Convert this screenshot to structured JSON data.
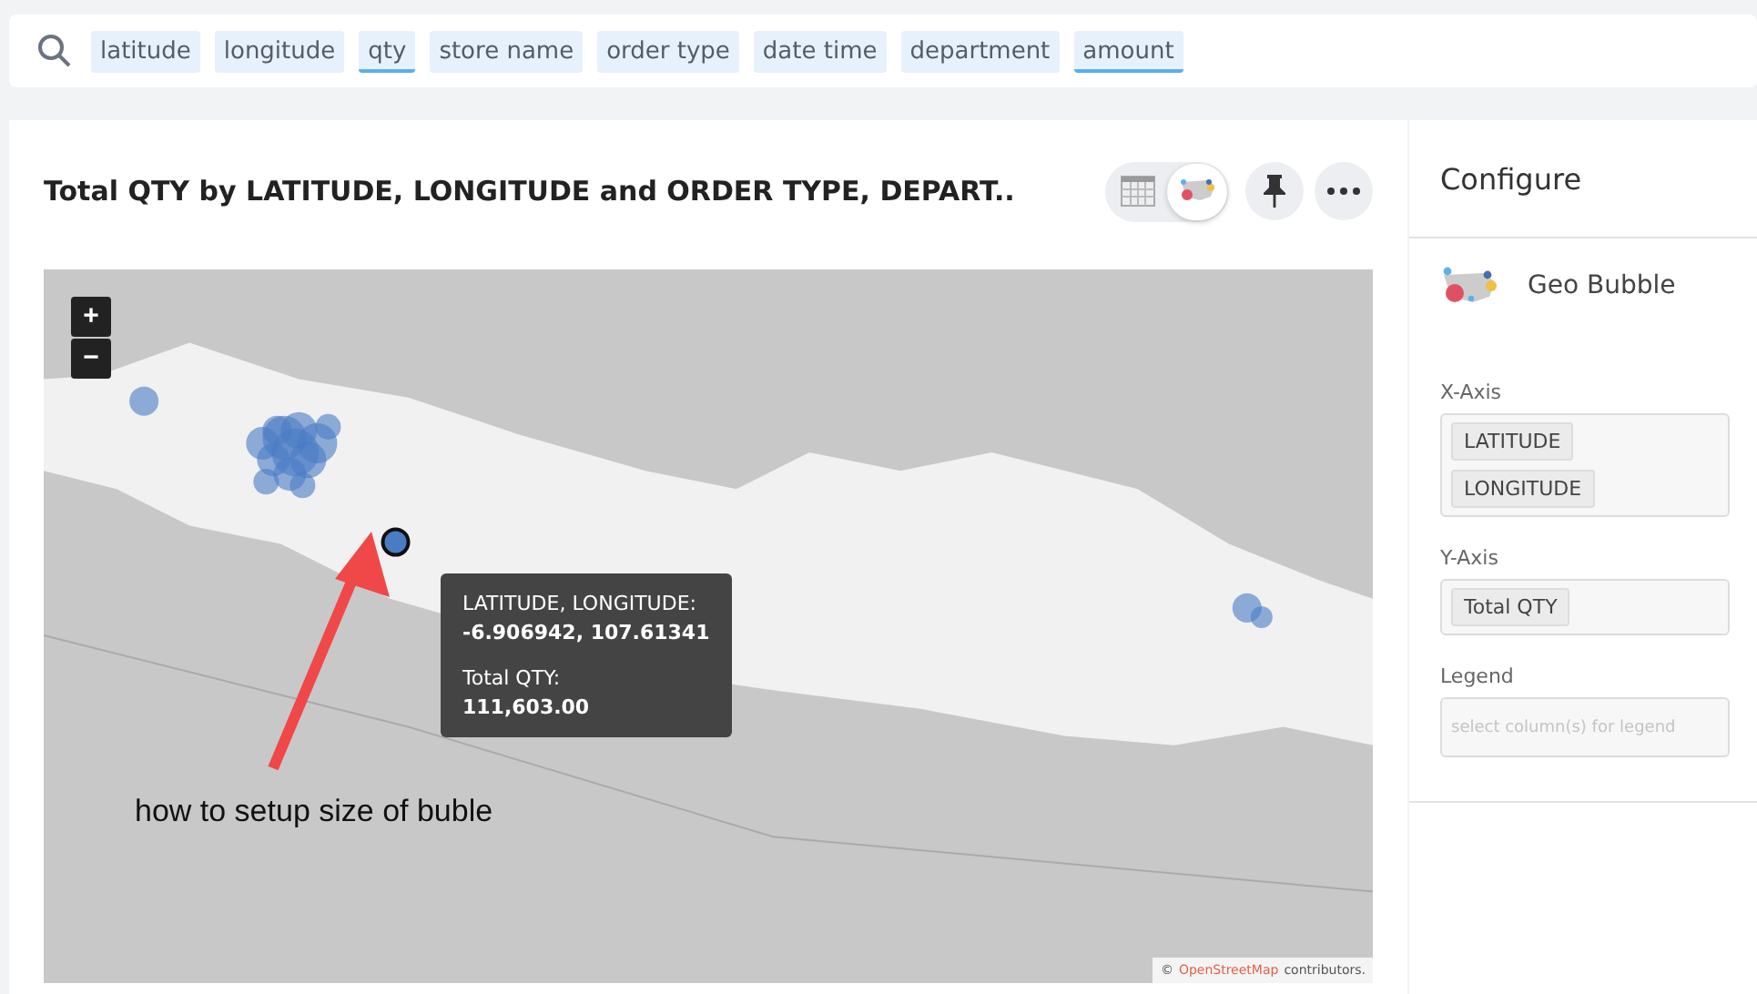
{
  "search": {
    "tokens": [
      {
        "label": "latitude",
        "underlined": false
      },
      {
        "label": "longitude",
        "underlined": false
      },
      {
        "label": "qty",
        "underlined": true
      },
      {
        "label": "store name",
        "underlined": false
      },
      {
        "label": "order type",
        "underlined": false
      },
      {
        "label": "date time",
        "underlined": false
      },
      {
        "label": "department",
        "underlined": false
      },
      {
        "label": "amount",
        "underlined": true
      }
    ]
  },
  "chart_card": {
    "title": "Total QTY by LATITUDE, LONGITUDE and ORDER TYPE, DEPART..",
    "view_toggle": [
      {
        "kind": "table",
        "selected": false
      },
      {
        "kind": "map",
        "selected": true
      }
    ],
    "map": {
      "zoom_in": "+",
      "zoom_out": "−",
      "tooltip": {
        "label_1": "LATITUDE, LONGITUDE:",
        "value_1": "-6.906942, 107.61341",
        "label_2": "Total QTY:",
        "value_2": "111,603.00"
      },
      "annotation": "how to setup size of buble",
      "attribution": {
        "symbol": "©",
        "link": "OpenStreetMap",
        "text": "contributors."
      }
    }
  },
  "configure": {
    "title": "Configure",
    "chart_type": "Geo Bubble",
    "sections": [
      {
        "label": "X-Axis",
        "chips": [
          "LATITUDE",
          "LONGITUDE"
        ]
      },
      {
        "label": "Y-Axis",
        "chips": [
          "Total QTY"
        ]
      },
      {
        "label": "Legend",
        "placeholder": "select column(s) for legend"
      }
    ]
  }
}
